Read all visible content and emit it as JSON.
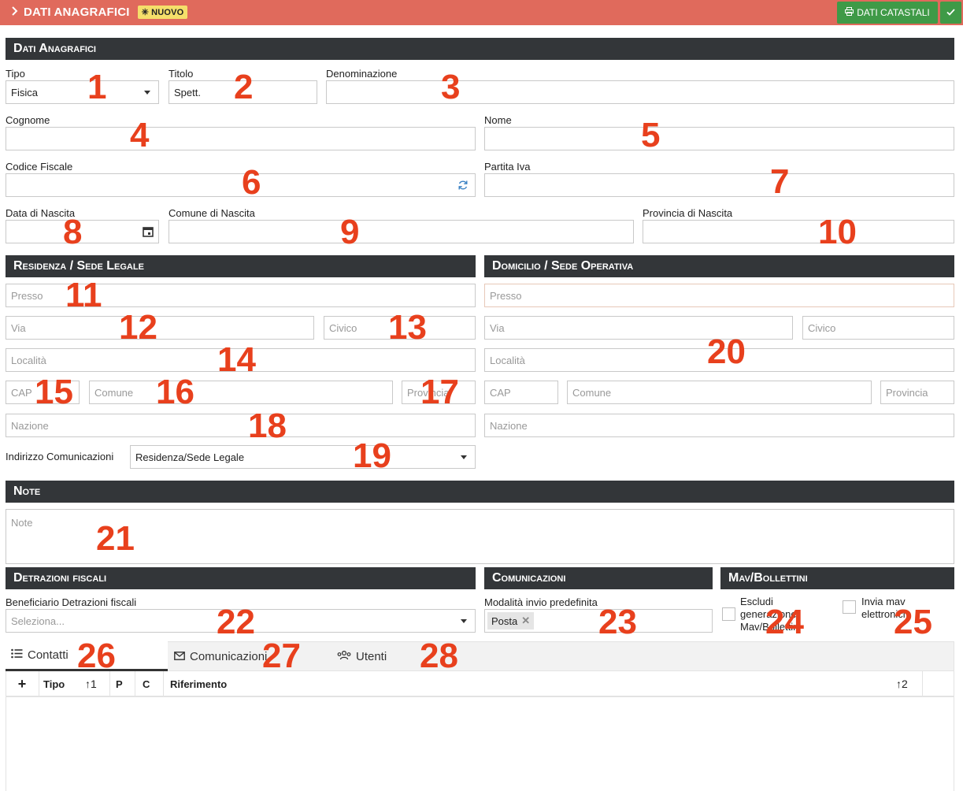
{
  "header": {
    "title": "DATI ANAGRAFICI",
    "badge": "NUOVO",
    "catastali_button": "DATI CATASTALI"
  },
  "sections": {
    "anagrafici": "Dati Anagrafici",
    "residenza": "Residenza / Sede Legale",
    "domicilio": "Domicilio / Sede Operativa",
    "note": "Note",
    "detrazioni": "Detrazioni fiscali",
    "comunicazioni": "Comunicazioni",
    "mav": "Mav/Bollettini"
  },
  "anagrafici": {
    "tipo_label": "Tipo",
    "tipo_value": "Fisica",
    "titolo_label": "Titolo",
    "titolo_value": "Spett.",
    "denominazione_label": "Denominazione",
    "cognome_label": "Cognome",
    "nome_label": "Nome",
    "codice_fiscale_label": "Codice Fiscale",
    "partita_iva_label": "Partita Iva",
    "data_nascita_label": "Data di Nascita",
    "comune_nascita_label": "Comune di Nascita",
    "provincia_nascita_label": "Provincia di Nascita"
  },
  "residenza": {
    "presso": "Presso",
    "via": "Via",
    "civico": "Civico",
    "localita": "Località",
    "cap": "CAP",
    "comune": "Comune",
    "provincia": "Provincia",
    "nazione": "Nazione",
    "indirizzo_label": "Indirizzo Comunicazioni",
    "indirizzo_value": "Residenza/Sede Legale"
  },
  "domicilio": {
    "presso": "Presso",
    "via": "Via",
    "civico": "Civico",
    "localita": "Località",
    "cap": "CAP",
    "comune": "Comune",
    "provincia": "Provincia",
    "nazione": "Nazione"
  },
  "note": {
    "placeholder": "Note"
  },
  "detrazioni": {
    "label": "Beneficiario Detrazioni fiscali",
    "placeholder": "Seleziona..."
  },
  "comunicazioni": {
    "label": "Modalità invio predefinita",
    "tag": "Posta"
  },
  "mav": {
    "escludi_label": "Escludi generazione Mav/Bollettini",
    "invia_label": "Invia mav elettronici"
  },
  "tabs": [
    {
      "label": "Contatti",
      "icon": "list-icon"
    },
    {
      "label": "Comunicazioni",
      "icon": "envelope-icon"
    },
    {
      "label": "Utenti",
      "icon": "users-icon"
    }
  ],
  "table": {
    "add": "+",
    "columns": [
      "Tipo",
      "P",
      "C",
      "Riferimento"
    ],
    "sort1": "↑1",
    "sort2": "↑2"
  },
  "annotations": [
    "1",
    "2",
    "3",
    "4",
    "5",
    "6",
    "7",
    "8",
    "9",
    "10",
    "11",
    "12",
    "13",
    "14",
    "15",
    "16",
    "17",
    "18",
    "19",
    "20",
    "21",
    "22",
    "23",
    "24",
    "25",
    "26",
    "27",
    "28"
  ],
  "colors": {
    "topbar": "#e06a5c",
    "section": "#333639",
    "green": "#3f9a47",
    "badge": "#f5df6a",
    "annotation": "#e8401d"
  }
}
